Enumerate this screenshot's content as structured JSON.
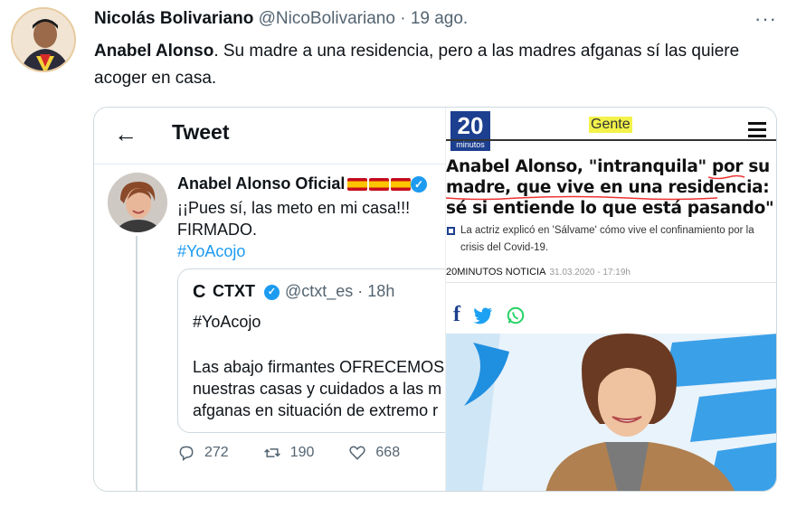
{
  "tweet": {
    "author_name": "Nicolás Bolivariano",
    "author_handle": "@NicoBolivariano",
    "date": "19 ago.",
    "more": "···",
    "text_bold": "Anabel Alonso",
    "text": ". Su madre a una residencia, pero a las madres afganas sí las quiere acoger en casa."
  },
  "embedded_tweet": {
    "back": "←",
    "header_title": "Tweet",
    "author_name": "Anabel Alonso Oficial",
    "verified": "✓",
    "line1": "¡¡Pues sí, las meto en mi casa!!!",
    "line2": "FIRMADO.",
    "hashtag": "#YoAcojo",
    "quote": {
      "logo": "C",
      "name": "CTXT",
      "verified": "✓",
      "handle_time": "@ctxt_es · 18h",
      "hashtag": "#YoAcojo",
      "body": [
        "Las abajo firmantes OFRECEMOS",
        "nuestras casas y cuidados a las m",
        "afganas en situación de extremo r"
      ]
    },
    "replies": "272",
    "retweets": "190",
    "likes": "668"
  },
  "article": {
    "logo_number": "20",
    "logo_word": "minutos",
    "section": "Gente",
    "headline": [
      "Anabel Alonso, \"intranquila\" por su",
      "madre, que vive en una residencia: \"No",
      "sé si entiende lo que está pasando\""
    ],
    "subtitle": "La actriz explicó en 'Sálvame' cómo vive el confinamiento por la crisis del Covid-19.",
    "byline": "20MINUTOS NOTICIA",
    "datetime": "31.03.2020 - 17:19h",
    "facebook": "f"
  },
  "colors": {
    "twitter_blue": "#1d9bf0",
    "brand_20m": "#1c3f8f",
    "whatsapp": "#25d366"
  }
}
